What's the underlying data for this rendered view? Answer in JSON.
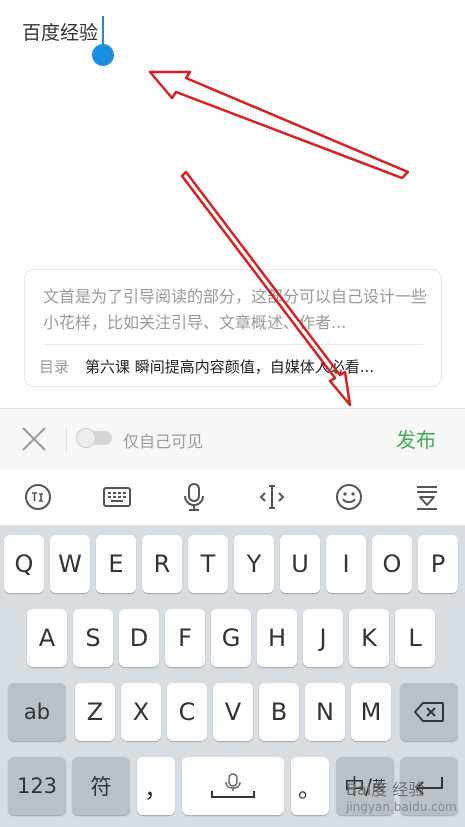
{
  "editor": {
    "title_value": "百度经验",
    "abstract_placeholder": "文首是为了引导阅读的部分，这部分可以自己设计一些小花样，比如关注引导、文章概述、作者...",
    "toc_label": "目录",
    "toc_text": "第六课 瞬间提高内容颜值，自媒体人必看..."
  },
  "actionbar": {
    "private_label": "仅自己可见",
    "publish_label": "发布",
    "toggle_on": false,
    "accent_color": "#3cae4f"
  },
  "ime_toolbar": {
    "icons": [
      "ime-logo-icon",
      "keyboard-icon",
      "microphone-icon",
      "cursor-move-icon",
      "emoji-icon",
      "collapse-keyboard-icon"
    ]
  },
  "keyboard": {
    "row1": [
      "Q",
      "W",
      "E",
      "R",
      "T",
      "Y",
      "U",
      "I",
      "O",
      "P"
    ],
    "row2": [
      "A",
      "S",
      "D",
      "F",
      "G",
      "H",
      "J",
      "K",
      "L"
    ],
    "row3": [
      "Z",
      "X",
      "C",
      "V",
      "B",
      "N",
      "M"
    ],
    "shift_label": "ab",
    "num_label": "123",
    "symbol_label": "符",
    "comma_label": "，",
    "period_label": "。",
    "lang_label": "中/",
    "lang_sub": "英"
  },
  "watermark": {
    "line1": "Bai度 经验",
    "line2": "jingyan.baidu.com"
  }
}
